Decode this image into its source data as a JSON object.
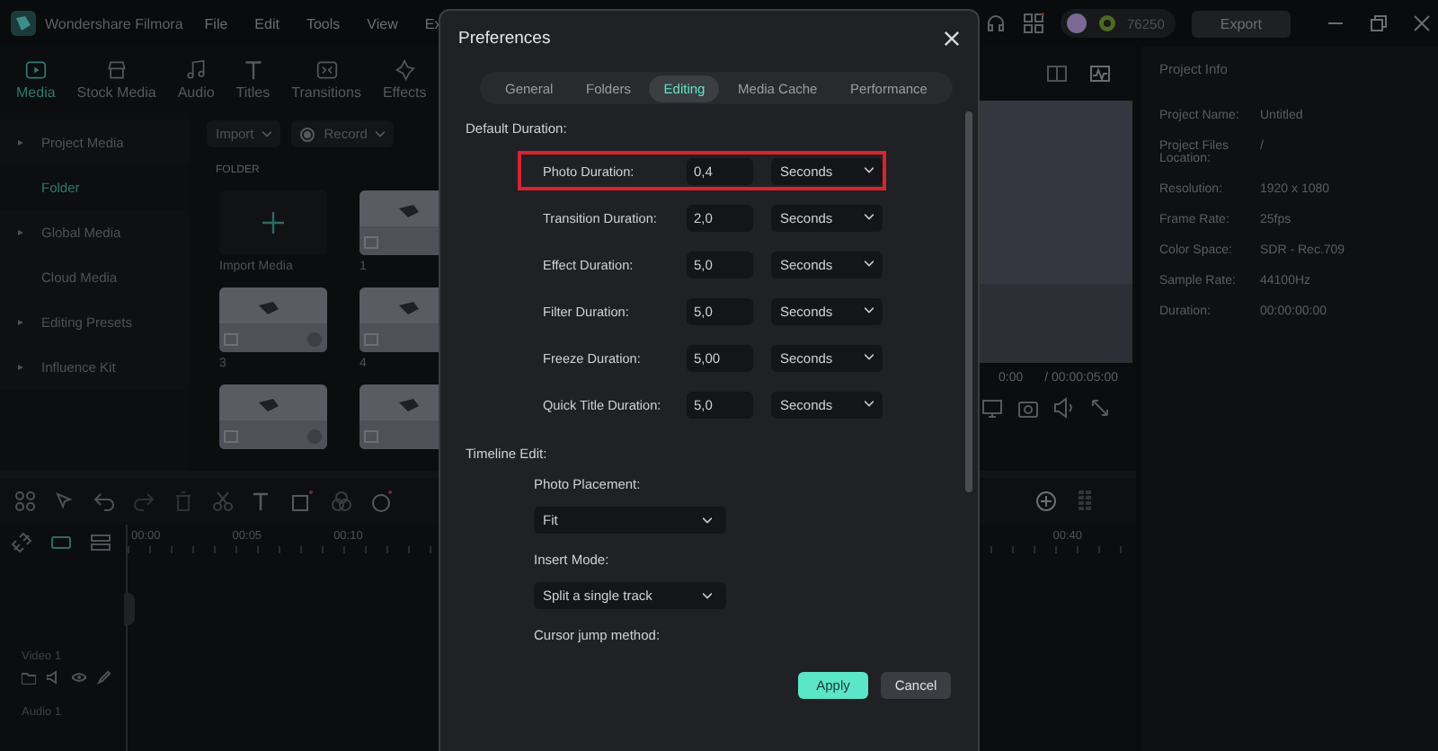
{
  "app_title": "Wondershare Filmora",
  "menu": [
    "File",
    "Edit",
    "Tools",
    "View",
    "Ex"
  ],
  "credits": "76250",
  "export_button": "Export",
  "media_tabs": [
    {
      "label": "Media",
      "selected": true
    },
    {
      "label": "Stock Media",
      "selected": false
    },
    {
      "label": "Audio",
      "selected": false
    },
    {
      "label": "Titles",
      "selected": false
    },
    {
      "label": "Transitions",
      "selected": false
    },
    {
      "label": "Effects",
      "selected": false
    }
  ],
  "sidebar": {
    "items": [
      {
        "label": "Project Media",
        "expandable": true,
        "selected": false
      },
      {
        "label": "Folder",
        "expandable": false,
        "selected": true
      },
      {
        "label": "Global Media",
        "expandable": true,
        "selected": false
      },
      {
        "label": "Cloud Media",
        "expandable": false,
        "selected": false
      },
      {
        "label": "Editing Presets",
        "expandable": true,
        "selected": false
      },
      {
        "label": "Influence Kit",
        "expandable": true,
        "selected": false
      }
    ]
  },
  "media": {
    "import": "Import",
    "record": "Record",
    "folder_heading": "FOLDER",
    "import_tile": "Import Media",
    "clips": [
      {
        "label": "1",
        "kind": "picture"
      },
      {
        "label": "3",
        "kind": "picture"
      },
      {
        "label": "4",
        "kind": "picture"
      },
      {
        "kind": "picture"
      },
      {
        "kind": "picture"
      }
    ]
  },
  "preview": {
    "current_time": "0:00",
    "total_time": "/ 00:00:05:00"
  },
  "project_info": {
    "title": "Project Info",
    "rows": [
      {
        "label": "Project Name:",
        "value": "Untitled"
      },
      {
        "label": "Project Files Location:",
        "value": "/"
      },
      {
        "label": "Resolution:",
        "value": "1920 x 1080"
      },
      {
        "label": "Frame Rate:",
        "value": "25fps"
      },
      {
        "label": "Color Space:",
        "value": "SDR - Rec.709"
      },
      {
        "label": "Sample Rate:",
        "value": "44100Hz"
      },
      {
        "label": "Duration:",
        "value": "00:00:00:00"
      }
    ]
  },
  "timeline": {
    "ruler": [
      "00:00",
      "00:05",
      "00:10",
      "00:40"
    ],
    "tracks": [
      {
        "label": "Video 1"
      },
      {
        "label": "Audio 1"
      }
    ]
  },
  "preferences": {
    "title": "Preferences",
    "tabs": [
      {
        "label": "General",
        "selected": false
      },
      {
        "label": "Folders",
        "selected": false
      },
      {
        "label": "Editing",
        "selected": true
      },
      {
        "label": "Media Cache",
        "selected": false
      },
      {
        "label": "Performance",
        "selected": false
      }
    ],
    "default_duration": {
      "heading": "Default Duration:",
      "rows": [
        {
          "label": "Photo Duration:",
          "value": "0,4",
          "unit": "Seconds",
          "highlighted": true
        },
        {
          "label": "Transition Duration:",
          "value": "2,0",
          "unit": "Seconds",
          "highlighted": false
        },
        {
          "label": "Effect Duration:",
          "value": "5,0",
          "unit": "Seconds",
          "highlighted": false
        },
        {
          "label": "Filter Duration:",
          "value": "5,0",
          "unit": "Seconds",
          "highlighted": false
        },
        {
          "label": "Freeze Duration:",
          "value": "5,00",
          "unit": "Seconds",
          "highlighted": false
        },
        {
          "label": "Quick Title Duration:",
          "value": "5,0",
          "unit": "Seconds",
          "highlighted": false
        }
      ]
    },
    "timeline_edit": {
      "heading": "Timeline Edit:",
      "settings": [
        {
          "label": "Photo Placement:",
          "value": "Fit"
        },
        {
          "label": "Insert Mode:",
          "value": "Split a single track"
        },
        {
          "label": "Cursor jump method:"
        }
      ]
    },
    "buttons": [
      {
        "label": "Apply",
        "kind": "primary"
      },
      {
        "label": "Cancel",
        "kind": "secondary"
      }
    ]
  }
}
